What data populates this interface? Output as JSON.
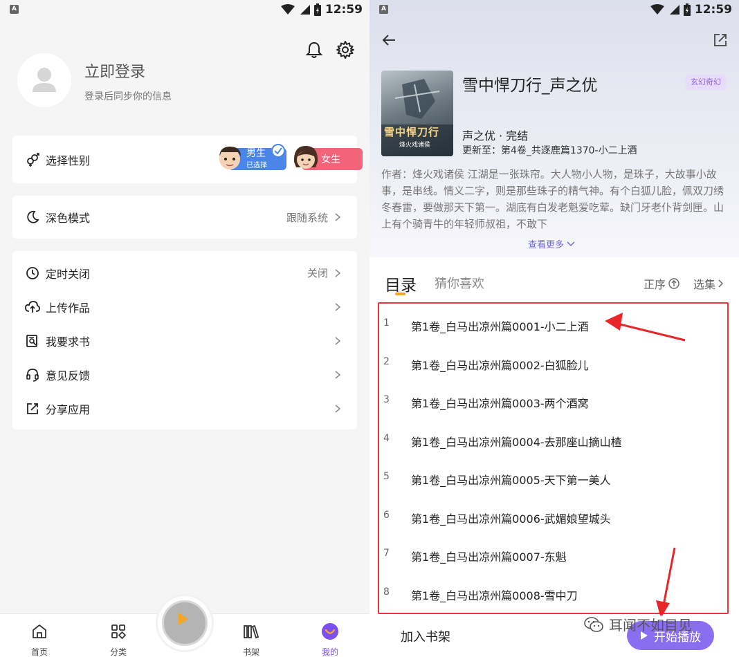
{
  "left": {
    "status": {
      "badge": "A",
      "time": "12:59"
    },
    "profile": {
      "title": "立即登录",
      "subtitle": "登录后同步你的信息"
    },
    "gender": {
      "label": "选择性别",
      "male": "男生",
      "male_sub": "已选择",
      "female": "女生"
    },
    "dark_mode": {
      "label": "深色模式",
      "value": "跟随系统"
    },
    "menu": [
      {
        "label": "定时关闭",
        "value": "关闭",
        "icon": "clock-icon"
      },
      {
        "label": "上传作品",
        "value": "",
        "icon": "cloud-upload-icon"
      },
      {
        "label": "我要求书",
        "value": "",
        "icon": "book-search-icon"
      },
      {
        "label": "意见反馈",
        "value": "",
        "icon": "headset-icon"
      },
      {
        "label": "分享应用",
        "value": "",
        "icon": "share-icon"
      }
    ],
    "nav": [
      {
        "label": "首页",
        "icon": "home-icon"
      },
      {
        "label": "分类",
        "icon": "grid-icon"
      },
      {
        "label": "书架",
        "icon": "bookshelf-icon"
      },
      {
        "label": "我的",
        "icon": "profile-icon"
      }
    ],
    "accent": "#7b4ff0"
  },
  "right": {
    "status": {
      "badge": "A",
      "time": "12:59"
    },
    "book": {
      "title": "雪中悍刀行_声之优",
      "genre": "玄幻奇幻",
      "meta1": "声之优 · 完结",
      "meta2": "更新至：第4卷_共逐鹿篇1370-小二上酒",
      "description": "作者：烽火戏诸侯 江湖是一张珠帘。大人物小人物，是珠子，大故事小故事，是串线。情义二字，则是那些珠子的精气神。有个白狐儿脸，佩双刀绣冬春雷，要做那天下第一。湖底有白发老魁爱吃荤。缺门牙老仆背剑匣。山上有个骑青牛的年轻师叔祖，不敢下",
      "more": "查看更多",
      "cover_title": "雪中悍刀行",
      "cover_sub": "烽火戏诸侯"
    },
    "tabs": {
      "active": "目录",
      "other": "猜你喜欢",
      "order": "正序",
      "pick": "选集"
    },
    "chapters": [
      {
        "num": "1",
        "title": "第1卷_白马出凉州篇0001-小二上酒"
      },
      {
        "num": "2",
        "title": "第1卷_白马出凉州篇0002-白狐脸儿"
      },
      {
        "num": "3",
        "title": "第1卷_白马出凉州篇0003-两个酒窝"
      },
      {
        "num": "4",
        "title": "第1卷_白马出凉州篇0004-去那座山摘山楂"
      },
      {
        "num": "5",
        "title": "第1卷_白马出凉州篇0005-天下第一美人"
      },
      {
        "num": "6",
        "title": "第1卷_白马出凉州篇0006-武媚娘望城头"
      },
      {
        "num": "7",
        "title": "第1卷_白马出凉州篇0007-东魁"
      },
      {
        "num": "8",
        "title": "第1卷_白马出凉州篇0008-雪中刀"
      }
    ],
    "bottom": {
      "add": "加入书架",
      "play": "开始播放"
    },
    "watermark": "耳闻不如目见"
  }
}
